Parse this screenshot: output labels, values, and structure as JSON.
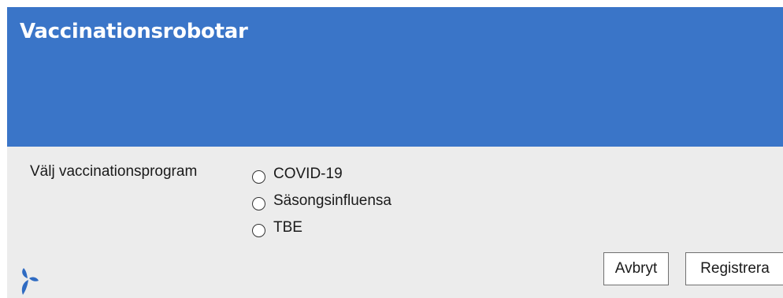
{
  "window": {
    "title": "Vaccinationsrobotar"
  },
  "form": {
    "program_label": "Välj vaccinationsprogram",
    "programs": [
      {
        "label": "COVID-19",
        "checked": false
      },
      {
        "label": "Säsongsinfluensa",
        "checked": false
      },
      {
        "label": "TBE",
        "checked": false
      }
    ]
  },
  "actions": {
    "cancel_label": "Avbryt",
    "register_label": "Registrera"
  },
  "icons": {
    "logo": "region-logo-icon"
  },
  "colors": {
    "header": "#3a75c8",
    "background": "#ececec",
    "logo": "#2f6bc2"
  }
}
